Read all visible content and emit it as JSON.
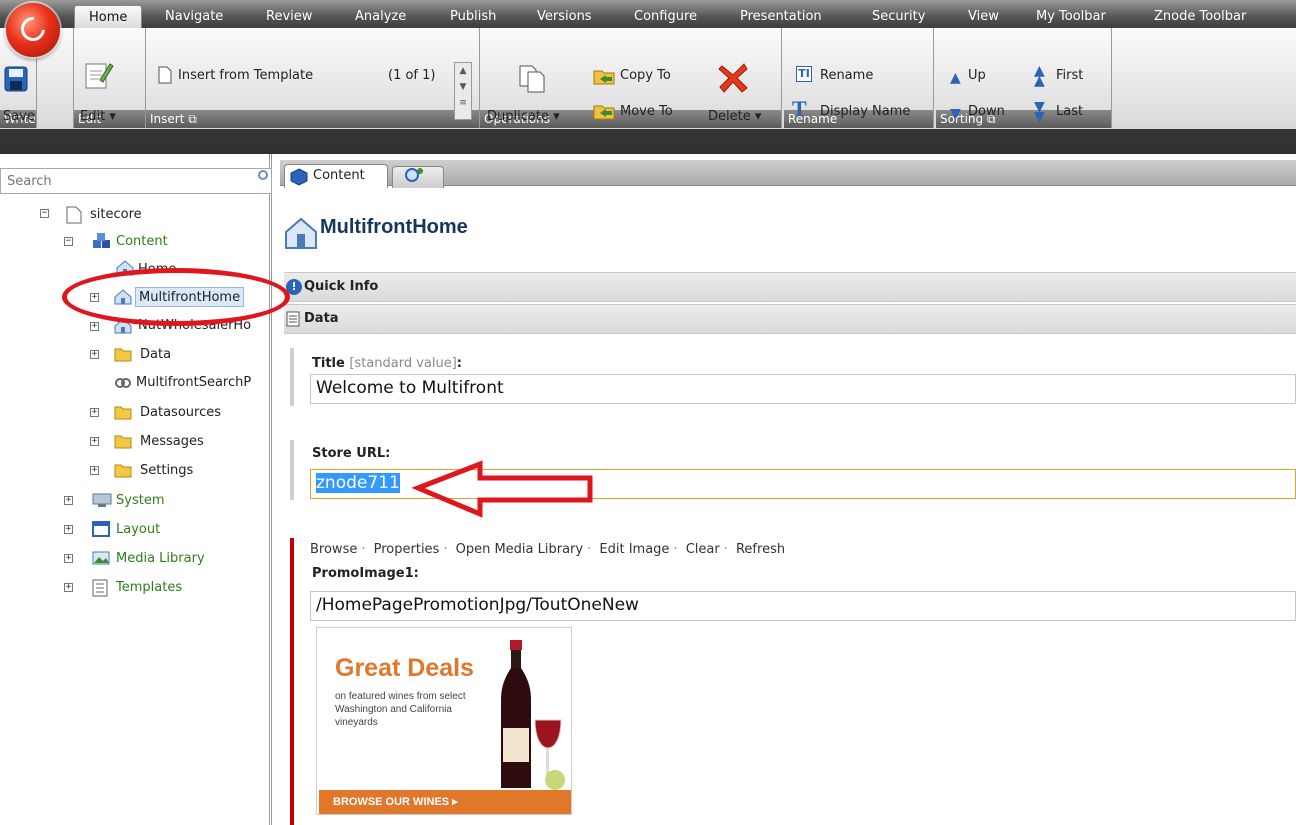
{
  "ribbon": {
    "tabs": [
      "Home",
      "Navigate",
      "Review",
      "Analyze",
      "Publish",
      "Versions",
      "Configure",
      "Presentation",
      "Security",
      "View",
      "My Toolbar",
      "Znode Toolbar"
    ],
    "groups": {
      "write": {
        "label": "Write",
        "save": "Save"
      },
      "edit": {
        "label": "Edit",
        "edit": "Edit"
      },
      "insert": {
        "label": "Insert",
        "template": "Insert from Template",
        "pager": "(1 of 1)"
      },
      "operations": {
        "label": "Operations",
        "duplicate": "Duplicate",
        "copy_to": "Copy To",
        "move_to": "Move To",
        "delete": "Delete"
      },
      "rename": {
        "label": "Rename",
        "rename": "Rename",
        "display_name": "Display Name"
      },
      "sorting": {
        "label": "Sorting",
        "up": "Up",
        "down": "Down",
        "first": "First",
        "last": "Last"
      }
    }
  },
  "tree": {
    "search_placeholder": "Search",
    "items": {
      "sitecore": "sitecore",
      "content": "Content",
      "home": "Home",
      "multifront_home": "MultifrontHome",
      "nut_wholesaler": "NutWholesalerHo",
      "data": "Data",
      "multifront_search": "MultifrontSearchP",
      "datasources": "Datasources",
      "messages": "Messages",
      "settings": "Settings",
      "system": "System",
      "layout": "Layout",
      "media_library": "Media Library",
      "templates": "Templates"
    }
  },
  "editor": {
    "tab_label": "Content",
    "item_title": "MultifrontHome",
    "sections": {
      "quick_info": "Quick Info",
      "data": "Data"
    },
    "fields": {
      "title_label": "Title",
      "title_hint": "[standard value]",
      "title_value": "Welcome to Multifront",
      "store_url_label": "Store URL:",
      "store_url_value": "znode711",
      "image_actions": [
        "Browse",
        "Properties",
        "Open Media Library",
        "Edit Image",
        "Clear",
        "Refresh"
      ],
      "promo_label": "PromoImage1:",
      "promo_path": "/HomePagePromotionJpg/ToutOneNew"
    },
    "promo_image": {
      "heading": "Great Deals",
      "body": "on featured wines from select Washington and California vineyards",
      "cta": "BROWSE OUR WINES ▸"
    }
  },
  "colors": {
    "accent_red": "#e0161d",
    "title_blue": "#17365d",
    "tree_green": "#2f7d1a",
    "promo_orange": "#e0772a"
  }
}
